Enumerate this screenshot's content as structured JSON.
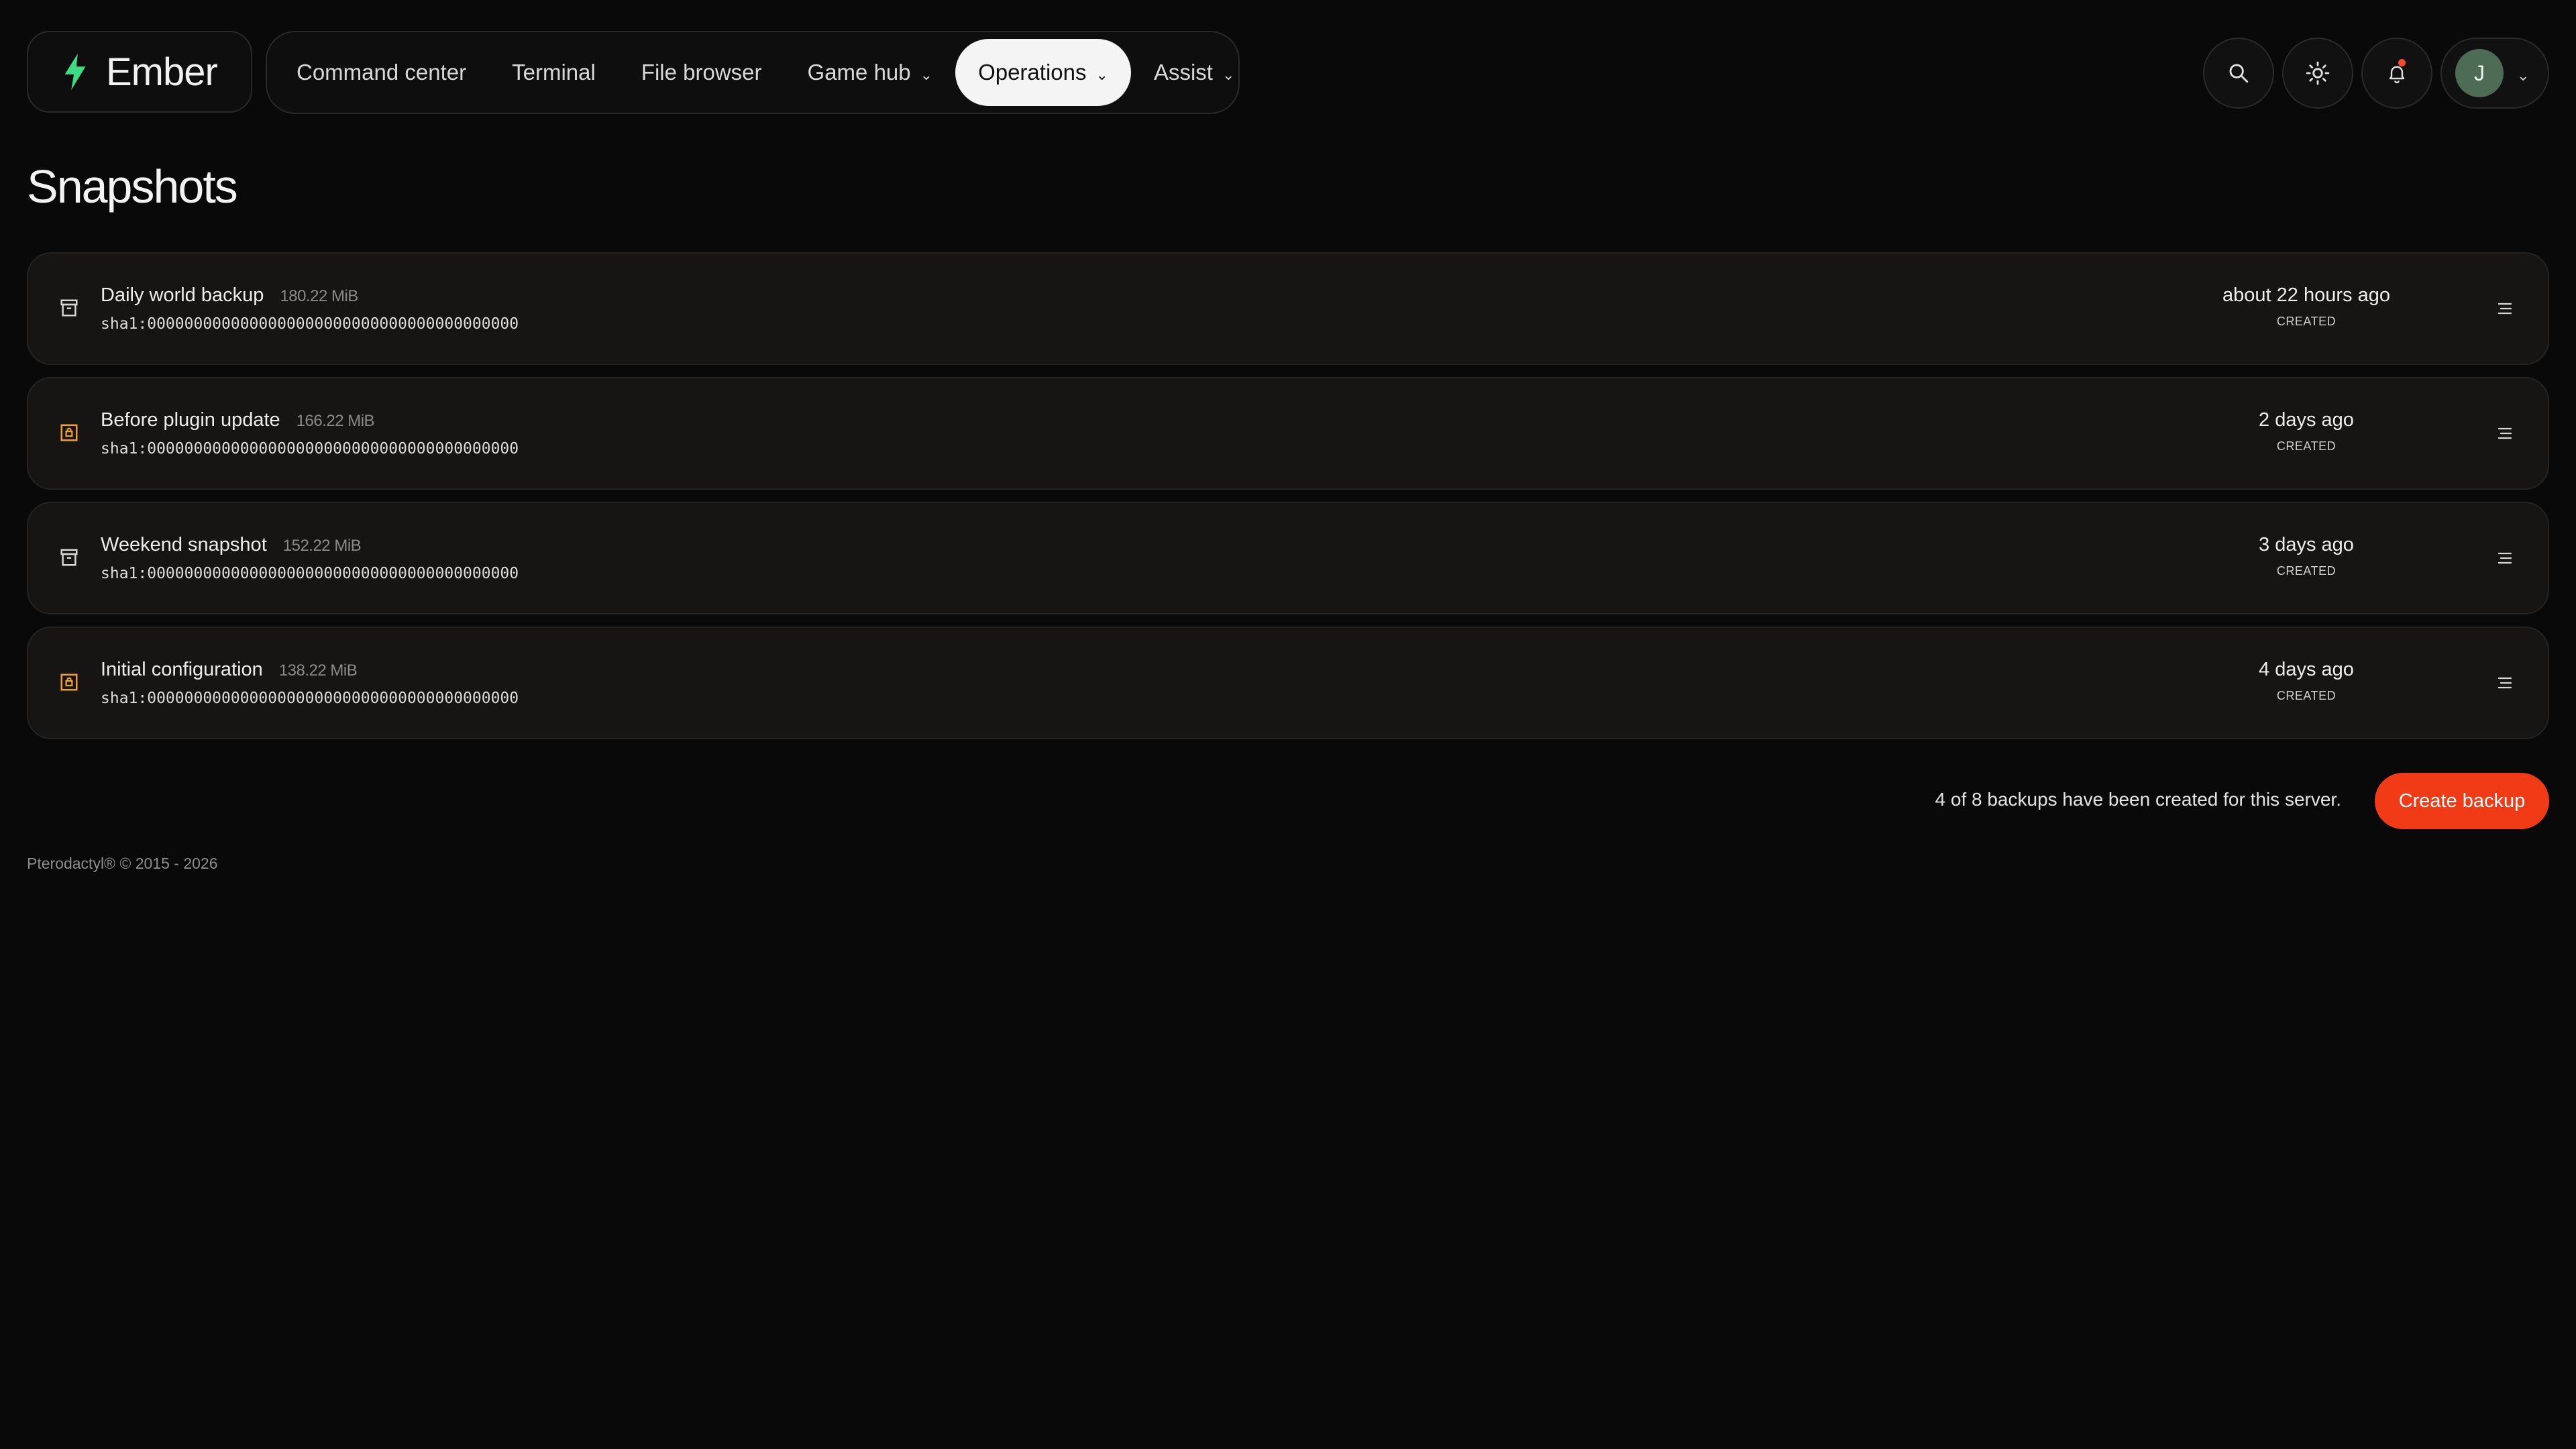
{
  "brand": {
    "name": "Ember",
    "accent": "#3ddc84"
  },
  "nav": {
    "items": [
      {
        "label": "Command center",
        "dropdown": false,
        "active": false
      },
      {
        "label": "Terminal",
        "dropdown": false,
        "active": false
      },
      {
        "label": "File browser",
        "dropdown": false,
        "active": false
      },
      {
        "label": "Game hub",
        "dropdown": true,
        "active": false
      },
      {
        "label": "Operations",
        "dropdown": true,
        "active": true
      },
      {
        "label": "Assist",
        "dropdown": true,
        "active": false
      }
    ]
  },
  "toolbar": {
    "search_icon": "search-icon",
    "theme_icon": "sun-icon",
    "notifications_icon": "bell-icon",
    "user_initial": "J"
  },
  "page": {
    "title": "Snapshots"
  },
  "backups": [
    {
      "name": "Daily world backup",
      "size": "180.22 MiB",
      "hash": "sha1:0000000000000000000000000000000000000000",
      "ago": "about 22 hours ago",
      "label": "CREATED",
      "icon": "archive-icon",
      "icon_color": "#d6d6d6"
    },
    {
      "name": "Before plugin update",
      "size": "166.22 MiB",
      "hash": "sha1:0000000000000000000000000000000000000000",
      "ago": "2 days ago",
      "label": "CREATED",
      "icon": "lock-icon",
      "icon_color": "#f0a030"
    },
    {
      "name": "Weekend snapshot",
      "size": "152.22 MiB",
      "hash": "sha1:0000000000000000000000000000000000000000",
      "ago": "3 days ago",
      "label": "CREATED",
      "icon": "archive-icon",
      "icon_color": "#d6d6d6"
    },
    {
      "name": "Initial configuration",
      "size": "138.22 MiB",
      "hash": "sha1:0000000000000000000000000000000000000000",
      "ago": "4 days ago",
      "label": "CREATED",
      "icon": "lock-icon",
      "icon_color": "#f0a030"
    }
  ],
  "summary": {
    "text": "4 of 8 backups have been created for this server."
  },
  "actions": {
    "create_label": "Create backup",
    "create_color": "#f03b16"
  },
  "footer": {
    "text": "Pterodactyl® © 2015 - 2026"
  }
}
